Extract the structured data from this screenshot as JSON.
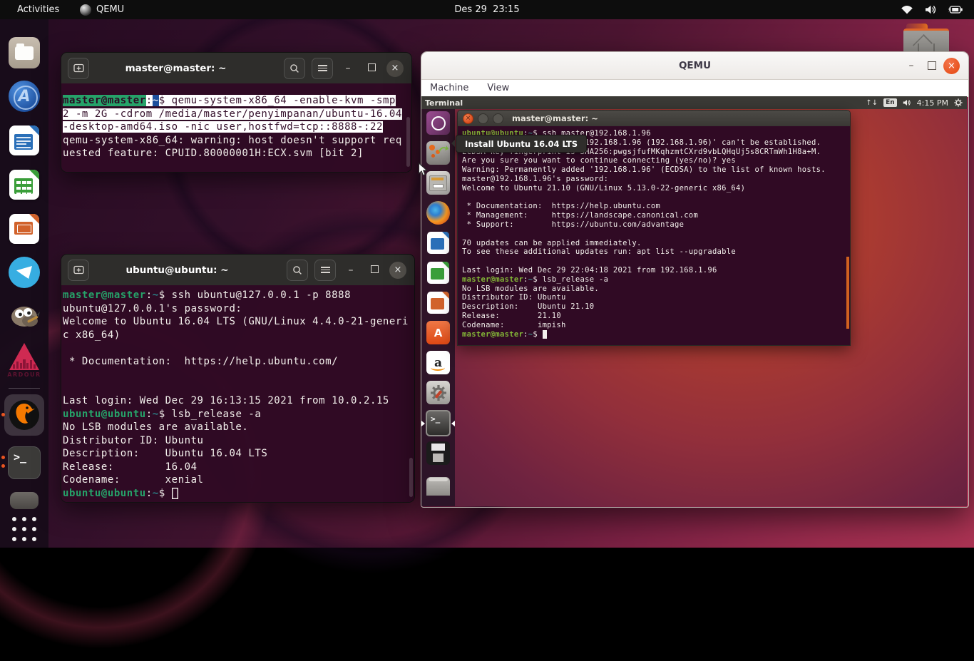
{
  "host": {
    "top_bar": {
      "activities_label": "Activities",
      "focused_app": "QEMU",
      "clock": "Des 29  23:15",
      "status_icons": [
        "wifi-icon",
        "volume-icon",
        "battery-icon"
      ]
    },
    "dock": {
      "items": [
        "files",
        "a-browser",
        "libreoffice-writer",
        "libreoffice-calc",
        "libreoffice-impress",
        "telegram",
        "gimp",
        "ardour",
        "qemu",
        "terminal",
        "more-app",
        "show-applications"
      ],
      "ardour_label": "ARDOUR",
      "terminal_glyph": ">_",
      "running_dots": {
        "qemu": 1,
        "terminal": 2
      }
    },
    "terminal1": {
      "title": "master@master: ~",
      "lines": [
        [
          [
            "sg",
            "master@master"
          ],
          [
            "sw",
            ":"
          ],
          [
            "sb",
            "~"
          ],
          [
            "sw",
            "$ qemu-system-x86_64 -enable-kvm -smp"
          ]
        ],
        [
          [
            "sw",
            "2 -m 2G -cdrom /media/master/penyimpanan/ubuntu-16.04"
          ]
        ],
        [
          [
            "sw",
            "-desktop-amd64.iso -nic user,hostfwd=tcp::8888-:22"
          ]
        ],
        [
          [
            "",
            "qemu-system-x86_64: warning: host doesn't support req"
          ]
        ],
        [
          [
            "",
            "uested feature: CPUID.80000001H:ECX.svm [bit 2]"
          ]
        ]
      ]
    },
    "terminal2": {
      "title": "ubuntu@ubuntu: ~",
      "lines": [
        [
          [
            "g",
            "master@master"
          ],
          [
            "w",
            ":"
          ],
          [
            "t",
            "~"
          ],
          [
            "w",
            "$ ssh ubuntu@127.0.0.1 -p 8888"
          ]
        ],
        [
          [
            "",
            "ubuntu@127.0.0.1's password:"
          ]
        ],
        [
          [
            "",
            "Welcome to Ubuntu 16.04 LTS (GNU/Linux 4.4.0-21-generi"
          ]
        ],
        [
          [
            "",
            "c x86_64)"
          ]
        ],
        [
          [
            "",
            ""
          ]
        ],
        [
          [
            "",
            " * Documentation:  https://help.ubuntu.com/"
          ]
        ],
        [
          [
            "",
            ""
          ]
        ],
        [
          [
            "",
            ""
          ]
        ],
        [
          [
            "",
            "Last login: Wed Dec 29 16:13:15 2021 from 10.0.2.15"
          ]
        ],
        [
          [
            "g",
            "ubuntu@ubuntu"
          ],
          [
            "w",
            ":"
          ],
          [
            "t",
            "~"
          ],
          [
            "w",
            "$ lsb_release -a"
          ]
        ],
        [
          [
            "",
            "No LSB modules are available."
          ]
        ],
        [
          [
            "",
            "Distributor ID: Ubuntu"
          ]
        ],
        [
          [
            "",
            "Description:    Ubuntu 16.04 LTS"
          ]
        ],
        [
          [
            "",
            "Release:        16.04"
          ]
        ],
        [
          [
            "",
            "Codename:       xenial"
          ]
        ],
        [
          [
            "g",
            "ubuntu@ubuntu"
          ],
          [
            "w",
            ":"
          ],
          [
            "t",
            "~"
          ],
          [
            "w",
            "$ "
          ],
          [
            "curh",
            " "
          ]
        ]
      ]
    }
  },
  "qemu_window": {
    "title": "QEMU",
    "menu": [
      "Machine",
      "View"
    ],
    "guest": {
      "panel": {
        "app_label": "Terminal",
        "keyboard_indicator": "En",
        "clock": "4:15 PM",
        "icons": [
          "network-arrows-icon",
          "volume-icon",
          "gear-icon"
        ]
      },
      "launcher_items": [
        "ubuntu-bfb",
        "install-ubuntu",
        "files",
        "firefox",
        "libreoffice-writer",
        "libreoffice-calc",
        "libreoffice-impress",
        "ubuntu-software",
        "amazon",
        "system-settings",
        "terminal",
        "floppy",
        "trash"
      ],
      "tooltip": "Install Ubuntu 16.04 LTS",
      "terminal": {
        "title": "master@master: ~",
        "terminal_glyph": ">_",
        "lines": [
          [
            [
              "g",
              "ubuntu@ubuntu"
            ],
            [
              "w",
              ":"
            ],
            [
              "t",
              "~"
            ],
            [
              "w",
              "$ ssh master@192.168.1.96"
            ]
          ],
          [
            [
              "",
              "The authenticity of host '192.168.1.96 (192.168.1.96)' can't be established."
            ]
          ],
          [
            [
              "",
              "ECDSA key fingerprint is SHA256:pwgsjfufMKqhzmtCXrd9vbLQHqUj5s8CRTmWh1H8a+M."
            ]
          ],
          [
            [
              "",
              "Are you sure you want to continue connecting (yes/no)? yes"
            ]
          ],
          [
            [
              "",
              "Warning: Permanently added '192.168.1.96' (ECDSA) to the list of known hosts."
            ]
          ],
          [
            [
              "",
              "master@192.168.1.96's password:"
            ]
          ],
          [
            [
              "",
              "Welcome to Ubuntu 21.10 (GNU/Linux 5.13.0-22-generic x86_64)"
            ]
          ],
          [
            [
              "",
              ""
            ]
          ],
          [
            [
              "",
              " * Documentation:  https://help.ubuntu.com"
            ]
          ],
          [
            [
              "",
              " * Management:     https://landscape.canonical.com"
            ]
          ],
          [
            [
              "",
              " * Support:        https://ubuntu.com/advantage"
            ]
          ],
          [
            [
              "",
              ""
            ]
          ],
          [
            [
              "",
              "70 updates can be applied immediately."
            ]
          ],
          [
            [
              "",
              "To see these additional updates run: apt list --upgradable"
            ]
          ],
          [
            [
              "",
              ""
            ]
          ],
          [
            [
              "",
              "Last login: Wed Dec 29 22:04:18 2021 from 192.168.1.96"
            ]
          ],
          [
            [
              "g",
              "master@master"
            ],
            [
              "w",
              ":"
            ],
            [
              "t",
              "~"
            ],
            [
              "w",
              "$ lsb_release -a"
            ]
          ],
          [
            [
              "",
              "No LSB modules are available."
            ]
          ],
          [
            [
              "",
              "Distributor ID: Ubuntu"
            ]
          ],
          [
            [
              "",
              "Description:    Ubuntu 21.10"
            ]
          ],
          [
            [
              "",
              "Release:        21.10"
            ]
          ],
          [
            [
              "",
              "Codename:       impish"
            ]
          ],
          [
            [
              "g",
              "master@master"
            ],
            [
              "w",
              ":"
            ],
            [
              "t",
              "~"
            ],
            [
              "w",
              "$ "
            ],
            [
              "cur",
              " "
            ]
          ]
        ]
      }
    }
  },
  "colors": {
    "accent_orange": "#e95420",
    "terminal_bg": "#300a24",
    "host_prompt_green": "#26a269",
    "guest_prompt_green": "#84b737",
    "selection_blue": "#1c4f9c",
    "guest_scrollbar_orange": "#d1611f"
  }
}
